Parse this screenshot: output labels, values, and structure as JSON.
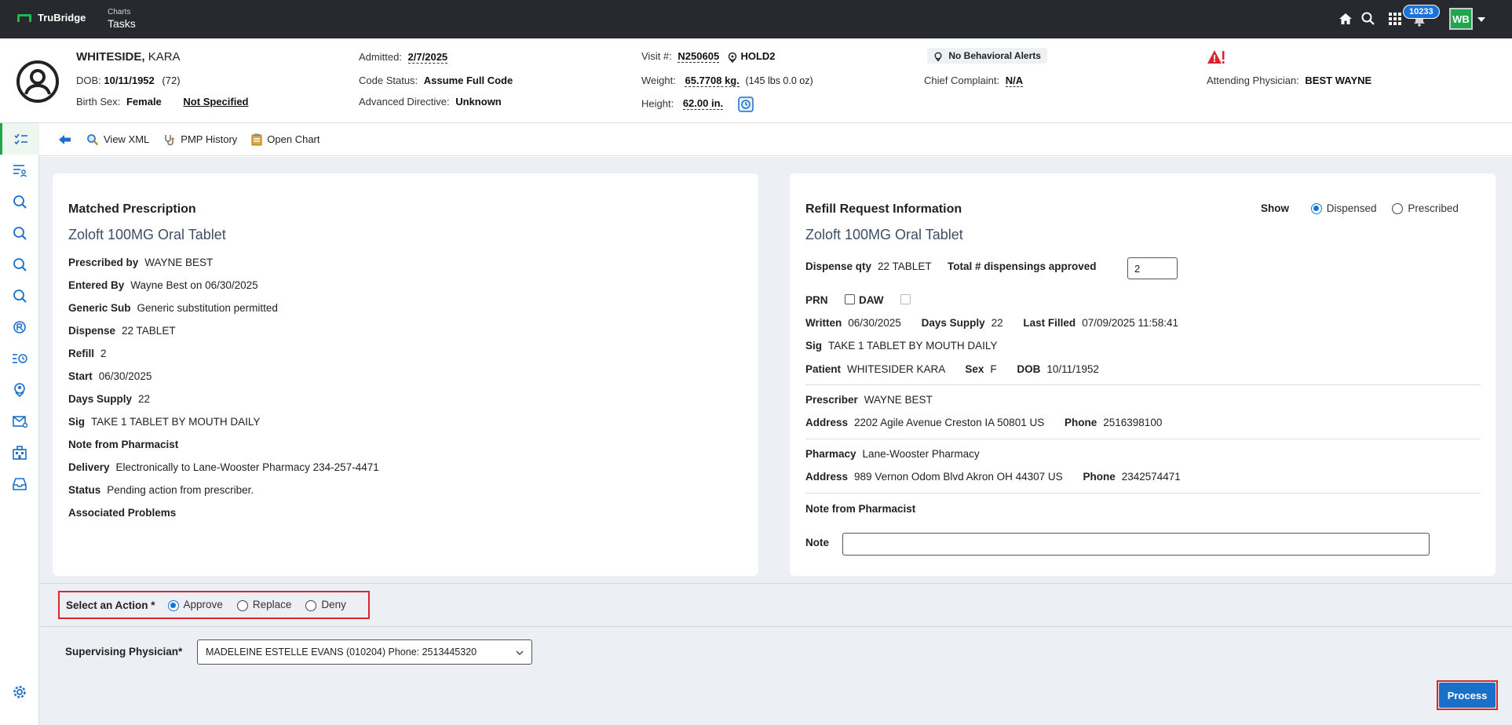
{
  "topbar": {
    "brand": "TruBridge",
    "crumb_small": "Charts",
    "crumb_big": "Tasks",
    "notification_count": "10233",
    "user_initials": "WB"
  },
  "patient": {
    "last_name": "WHITESIDE,",
    "first_name": "KARA",
    "dob_label": "DOB:",
    "dob": "10/11/1952",
    "age": "(72)",
    "sex_label": "Birth Sex:",
    "sex": "Female",
    "not_specified": "Not Specified",
    "admitted_label": "Admitted:",
    "admitted": "2/7/2025",
    "code_status_label": "Code Status:",
    "code_status": "Assume Full Code",
    "adv_dir_label": "Advanced Directive:",
    "adv_dir": "Unknown",
    "visit_label": "Visit #:",
    "visit": "N250605",
    "location": "HOLD2",
    "weight_label": "Weight:",
    "weight": "65.7708 kg.",
    "weight_alt": "(145 lbs 0.0 oz)",
    "height_label": "Height:",
    "height": "62.00 in.",
    "behavioral": "No Behavioral Alerts",
    "complaint_label": "Chief Complaint:",
    "complaint": "N/A",
    "attending_label": "Attending Physician:",
    "attending": "BEST WAYNE"
  },
  "toolbar": {
    "view_xml": "View XML",
    "pmp_history": "PMP History",
    "open_chart": "Open Chart"
  },
  "matched": {
    "title": "Matched Prescription",
    "drug": "Zoloft 100MG Oral Tablet",
    "prescribed_by_label": "Prescribed by",
    "prescribed_by": "WAYNE BEST",
    "entered_by_label": "Entered By",
    "entered_by": "Wayne Best on 06/30/2025",
    "generic_sub_label": "Generic Sub",
    "generic_sub": "Generic substitution permitted",
    "dispense_label": "Dispense",
    "dispense": "22 TABLET",
    "refill_label": "Refill",
    "refill": "2",
    "start_label": "Start",
    "start": "06/30/2025",
    "days_supply_label": "Days Supply",
    "days_supply": "22",
    "sig_label": "Sig",
    "sig": "TAKE 1 TABLET BY MOUTH DAILY",
    "note_label": "Note from Pharmacist",
    "delivery_label": "Delivery",
    "delivery": "Electronically to Lane-Wooster Pharmacy 234-257-4471",
    "status_label": "Status",
    "status": "Pending action from prescriber.",
    "problems_label": "Associated Problems"
  },
  "refill": {
    "title": "Refill Request Information",
    "show_label": "Show",
    "show_dispensed": "Dispensed",
    "show_prescribed": "Prescribed",
    "drug": "Zoloft 100MG Oral Tablet",
    "dispense_qty_label": "Dispense qty",
    "dispense_qty": "22 TABLET",
    "total_label": "Total # dispensings approved",
    "total": "2",
    "prn_label": "PRN",
    "daw_label": "DAW",
    "written_label": "Written",
    "written": "06/30/2025",
    "days_supply_label": "Days Supply",
    "days_supply": "22",
    "last_filled_label": "Last Filled",
    "last_filled": "07/09/2025 11:58:41",
    "sig_label": "Sig",
    "sig": "TAKE 1 TABLET BY MOUTH DAILY",
    "patient_label": "Patient",
    "patient": "WHITESIDER KARA",
    "sex_label": "Sex",
    "sex": "F",
    "dob_label": "DOB",
    "dob": "10/11/1952",
    "prescriber_label": "Prescriber",
    "prescriber": "WAYNE BEST",
    "address_label": "Address",
    "prescriber_address": "2202 Agile Avenue Creston IA 50801 US",
    "phone_label": "Phone",
    "prescriber_phone": "2516398100",
    "pharmacy_label": "Pharmacy",
    "pharmacy": "Lane-Wooster Pharmacy",
    "pharmacy_address": "989 Vernon Odom Blvd Akron OH 44307 US",
    "pharmacy_phone": "2342574471",
    "note_from_label": "Note from Pharmacist",
    "note_label": "Note",
    "note_value": ""
  },
  "action": {
    "label": "Select an Action *",
    "approve": "Approve",
    "replace": "Replace",
    "deny": "Deny",
    "supervising_label": "Supervising Physician*",
    "supervising_value": "MADELEINE ESTELLE EVANS (010204) Phone: 2513445320",
    "process": "Process"
  }
}
